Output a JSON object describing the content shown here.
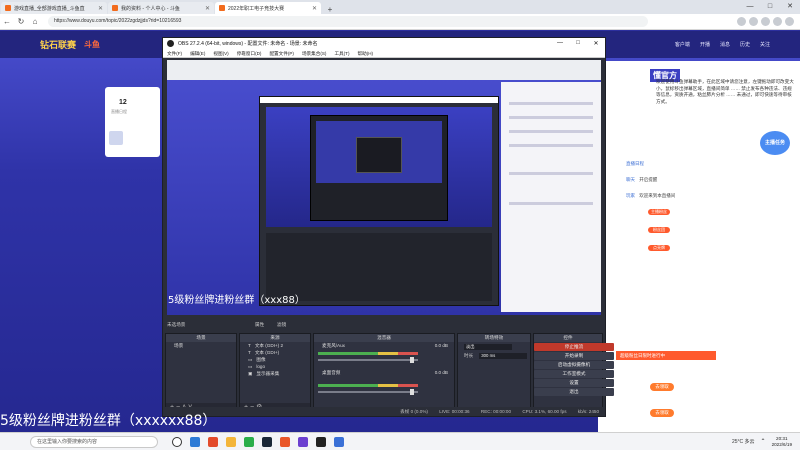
{
  "browser": {
    "tabs": [
      {
        "label": "游戏直播_全部游戏直播_斗鱼直",
        "active": false
      },
      {
        "label": "我的资料 - 个人中心 - 斗鱼",
        "active": false
      },
      {
        "label": "2022年职工电子竞技大赛",
        "active": true
      }
    ],
    "url": "https://www.douyu.com/topic/2022zgdzjjds?rid=10216593",
    "new_tab": "+",
    "window_controls": [
      "—",
      "□",
      "✕"
    ]
  },
  "page": {
    "logo_text": "钻石联赛",
    "logo_sub": "斗鱼",
    "header_links": [
      "客户端",
      "开播",
      "消息",
      "历史",
      "关注"
    ],
    "profile": {
      "count": "12",
      "sub": "直播日程"
    },
    "chat": {
      "title": "懂官方",
      "welcome": "欢迎使用斗鱼弹幕助手，在此区域中请您注意，左键拖动即可改变大小，鼠标移出弹幕区域，直播间简单 …… 禁止发布各种违法、违规等信息，资质开通，粘丝肺片分析 …… 未通过，即可快速等待审核方式。",
      "badge": "主播任务",
      "announce": "欢迎来到本直播间",
      "messages": [
        {
          "name": "直播日程",
          "text": ""
        },
        {
          "name": "聊天",
          "text": "开启提醒"
        },
        {
          "name": "玩家",
          "text": "欢迎来到本直播间"
        }
      ],
      "tags": [
        "主播粉丝",
        "粉丝团",
        "点亮牌"
      ],
      "receive_labels": [
        "去领取",
        "去领取",
        "去领取",
        "去领取"
      ],
      "notice": "超级粉丝日限时进行中"
    }
  },
  "obs": {
    "title": "OBS 27.2.4 (64-bit, windows) - 配置文件: 未命名 - 场景: 未命名",
    "menu": [
      "文件(F)",
      "编辑(E)",
      "视图(V)",
      "停靠窗口(D)",
      "配置文件(P)",
      "场景集合(S)",
      "工具(T)",
      "帮助(H)"
    ],
    "scene_label": "未选场景",
    "props_label": "属性",
    "filters_label": "滤镜",
    "docks": {
      "scenes": {
        "title": "场景",
        "items": [
          "场景"
        ]
      },
      "sources": {
        "title": "来源",
        "items": [
          "文本 (GDI+) 2",
          "文本 (GDI+)",
          "图像",
          "logo",
          "显示器采集"
        ]
      },
      "mixer": {
        "title": "混音器",
        "tracks": [
          {
            "name": "麦克风/Aux",
            "db": "0.0 dB"
          },
          {
            "name": "桌面音频",
            "db": "0.0 dB"
          }
        ]
      },
      "transitions": {
        "title": "转场特效",
        "type": "淡出",
        "duration_label": "时长",
        "duration": "300 ms"
      },
      "controls": {
        "title": "控件",
        "buttons": [
          "停止推流",
          "开始录制",
          "启动虚拟摄像机",
          "工作室模式",
          "设置",
          "退出"
        ]
      }
    },
    "status": {
      "dropped": "丢帧 0 (0.0%)",
      "live": "LIVE: 00:00:36",
      "rec": "REC: 00:00:00",
      "cpu": "CPU: 3.1%, 60.00 fps",
      "kbps": "kb/s: 2450"
    }
  },
  "overlay": {
    "bottom_text": "5级粉丝牌进粉丝群（xxxxxx88）",
    "preview_text": "5级粉丝牌进粉丝群（xxx88）"
  },
  "taskbar": {
    "search_placeholder": "在这里输入你要搜索的内容",
    "weather": "25°C 多云",
    "time": "20:31",
    "date": "2022/6/19"
  }
}
